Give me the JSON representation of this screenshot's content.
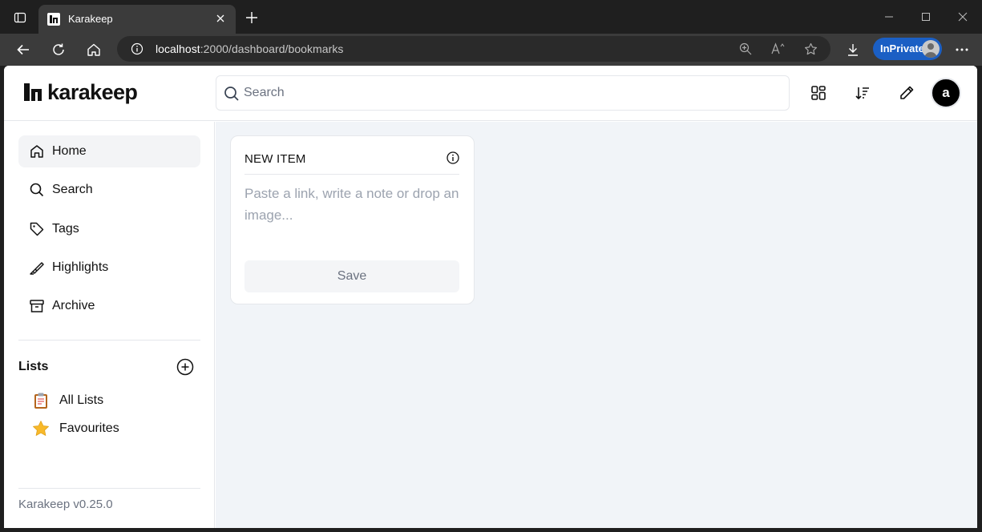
{
  "browser": {
    "tab_title": "Karakeep",
    "url_host": "localhost",
    "url_rest": ":2000/dashboard/bookmarks",
    "inprivate_label": "InPrivate"
  },
  "header": {
    "logo_text": "karakeep",
    "search_placeholder": "Search",
    "avatar_letter": "a"
  },
  "sidebar": {
    "items": [
      {
        "label": "Home",
        "icon": "home-icon",
        "active": true
      },
      {
        "label": "Search",
        "icon": "search-icon"
      },
      {
        "label": "Tags",
        "icon": "tag-icon"
      },
      {
        "label": "Highlights",
        "icon": "highlighter-icon"
      },
      {
        "label": "Archive",
        "icon": "archive-icon"
      }
    ],
    "lists_title": "Lists",
    "lists": [
      {
        "label": "All Lists",
        "icon": "clipboard-emoji"
      },
      {
        "label": "Favourites",
        "icon": "star-emoji"
      }
    ],
    "version": "Karakeep v0.25.0"
  },
  "new_item": {
    "title": "NEW ITEM",
    "placeholder": "Paste a link, write a note or drop an image...",
    "save_label": "Save"
  },
  "colors": {
    "inprivate_accent": "#1b5fc4",
    "main_bg": "#f1f4f8",
    "avatar_bg": "#000000"
  }
}
